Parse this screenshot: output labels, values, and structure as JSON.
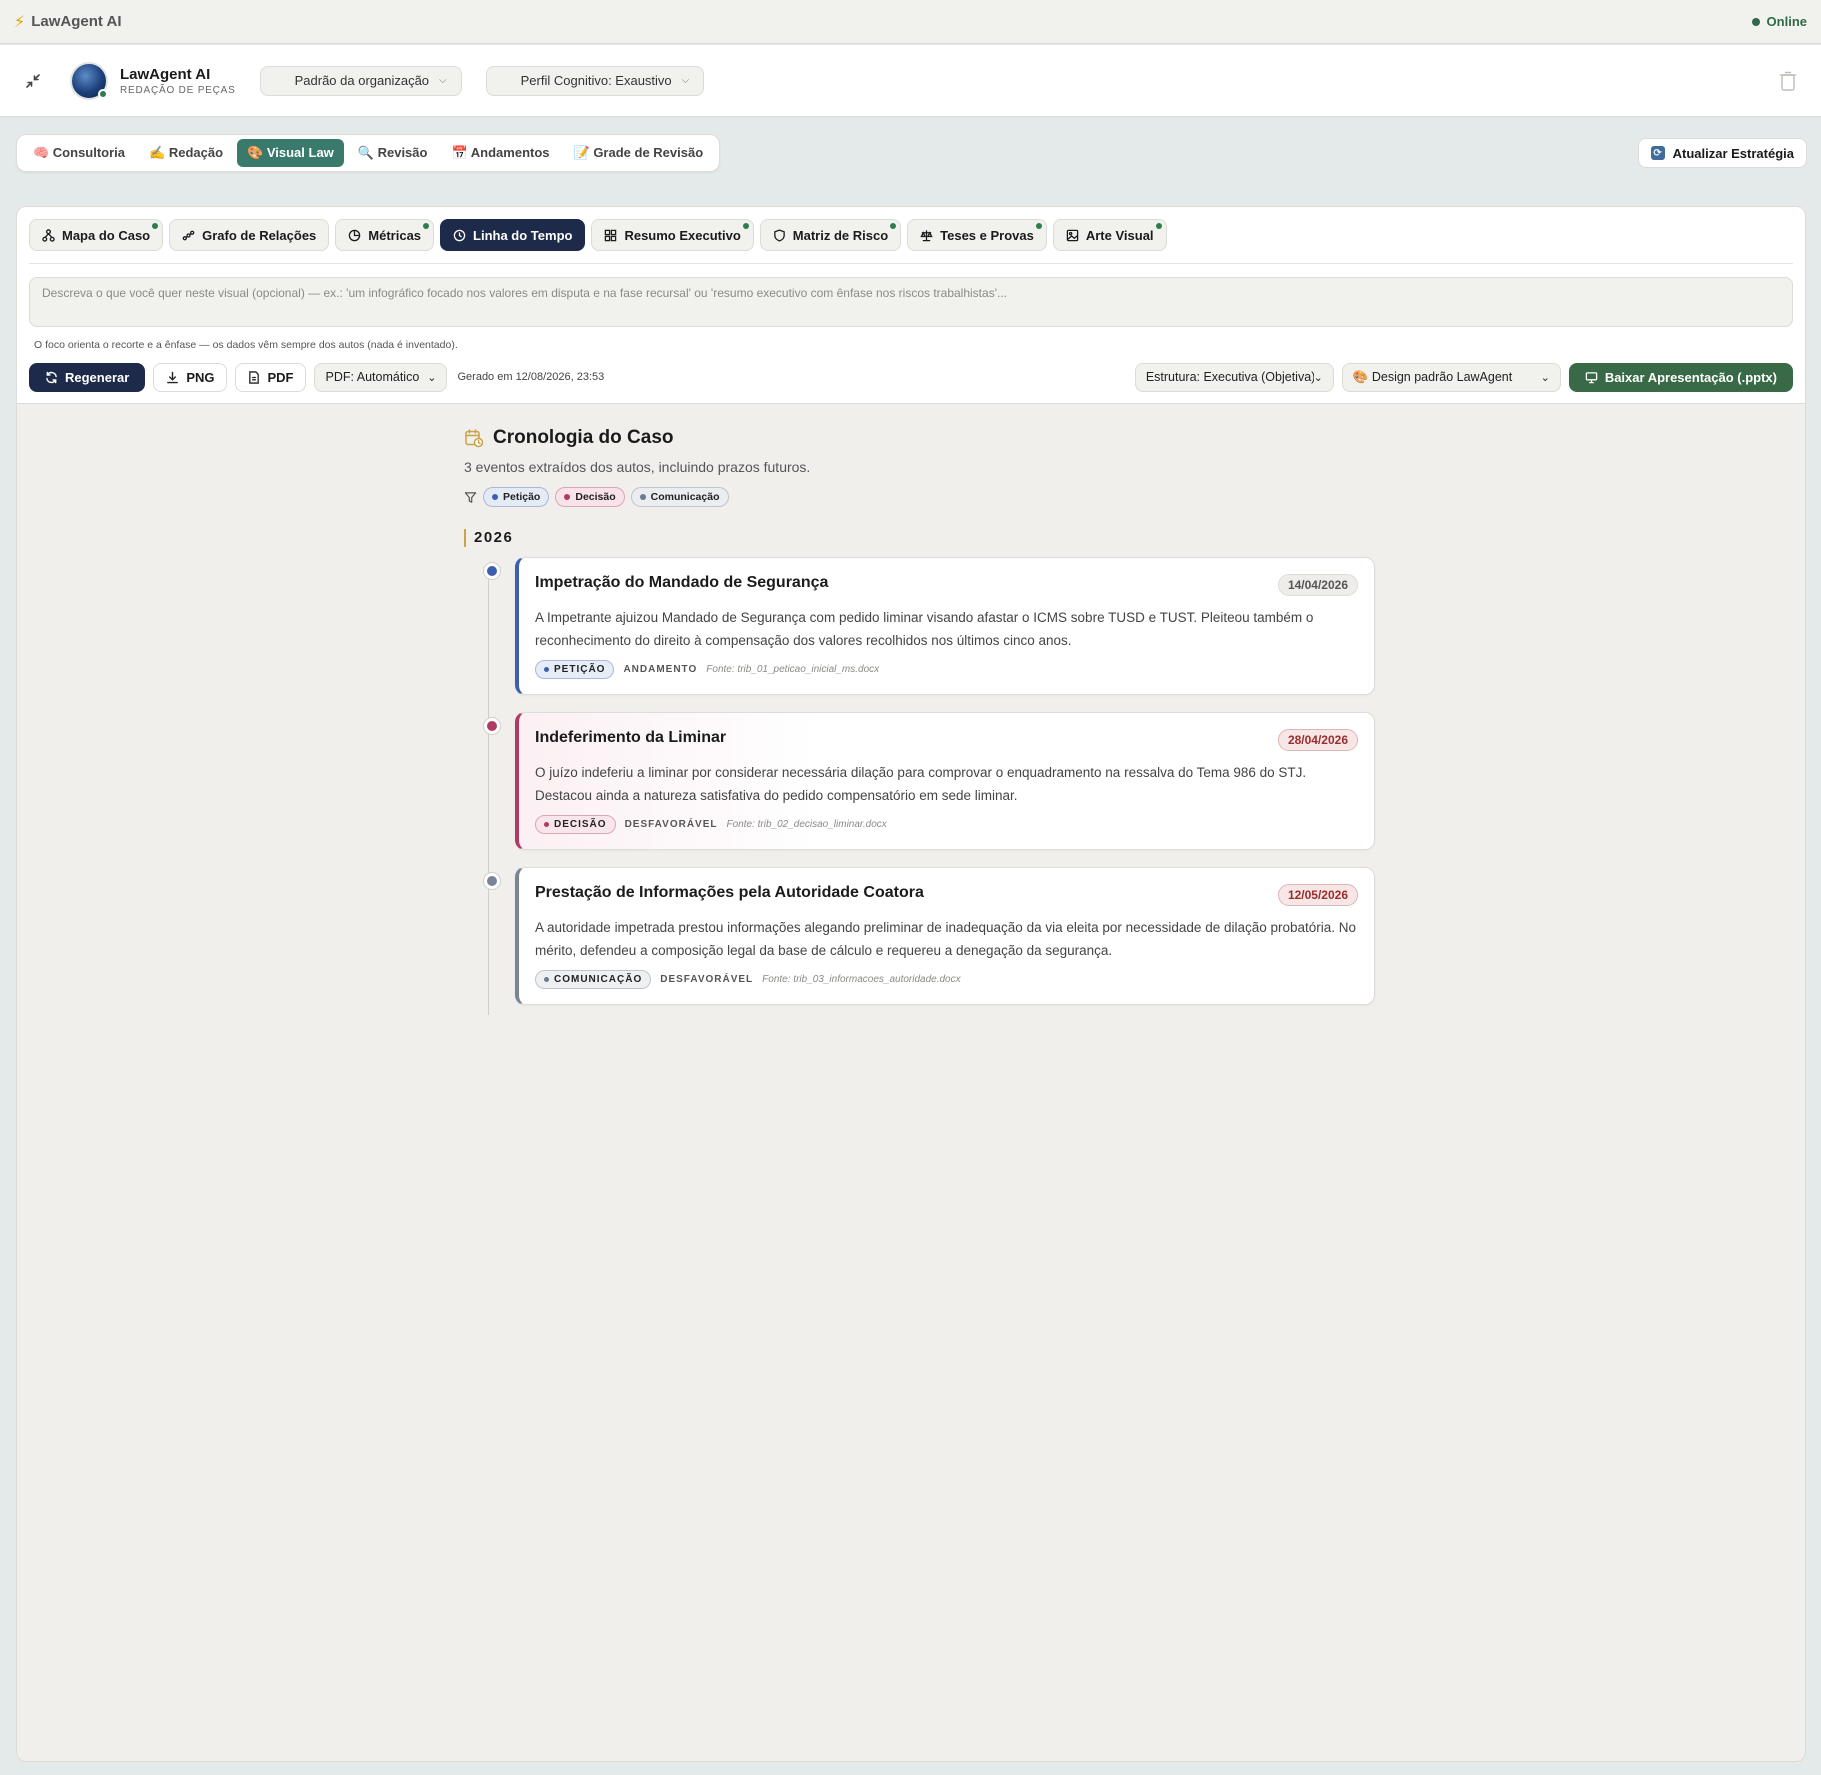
{
  "app": {
    "title": "LawAgent AI",
    "status": "Online"
  },
  "agent": {
    "name": "LawAgent AI",
    "subtitle": "REDAÇÃO DE PEÇAS",
    "org_profile": "Padrão da organização",
    "cognitive_profile": "Perfil Cognitivo: Exaustivo"
  },
  "main_tabs": [
    {
      "label": "🧠 Consultoria"
    },
    {
      "label": "✍️ Redação"
    },
    {
      "label": "🎨 Visual Law"
    },
    {
      "label": "🔍 Revisão"
    },
    {
      "label": "📅 Andamentos"
    },
    {
      "label": "📝 Grade de Revisão"
    }
  ],
  "active_main_tab": "Visual Law",
  "update_strategy_label": "Atualizar Estratégia",
  "sub_tabs": [
    {
      "label": "Mapa do Caso",
      "icon": "sitemap-icon"
    },
    {
      "label": "Grafo de Relações",
      "icon": "graph-icon"
    },
    {
      "label": "Métricas",
      "icon": "pie-chart-icon"
    },
    {
      "label": "Linha do Tempo",
      "icon": "clock-icon"
    },
    {
      "label": "Resumo Executivo",
      "icon": "dashboard-icon"
    },
    {
      "label": "Matriz de Risco",
      "icon": "shield-icon"
    },
    {
      "label": "Teses e Provas",
      "icon": "scale-icon"
    },
    {
      "label": "Arte Visual",
      "icon": "image-icon"
    }
  ],
  "prompt": {
    "placeholder": "Descreva o que você quer neste visual (opcional) — ex.: 'um infográfico focado nos valores em disputa e na fase recursal' ou 'resumo executivo com ênfase nos riscos trabalhistas'..."
  },
  "hint": "O foco orienta o recorte e a ênfase — os dados vêm sempre dos autos (nada é inventado).",
  "actions": {
    "regenerate": "Regenerar",
    "png": "PNG",
    "pdf": "PDF",
    "pdf_mode": "PDF: Automático",
    "generated_at": "Gerado em 12/08/2026, 23:53",
    "structure": "Estrutura: Executiva (Objetiva)",
    "design": "🎨 Design padrão LawAgent",
    "download": "Baixar Apresentação (.pptx)"
  },
  "timeline": {
    "title": "Cronologia do Caso",
    "subtitle": "3 eventos extraídos dos autos, incluindo prazos futuros.",
    "filters": [
      "Petição",
      "Decisão",
      "Comunicação"
    ],
    "year": "2026",
    "events": [
      {
        "title": "Impetração do Mandado de Segurança",
        "date": "14/04/2026",
        "description": "A Impetrante ajuizou Mandado de Segurança com pedido liminar visando afastar o ICMS sobre TUSD e TUST. Pleiteou também o reconhecimento do direito à compensação dos valores recolhidos nos últimos cinco anos.",
        "tag": "PETIÇÃO",
        "kind": "ANDAMENTO",
        "source": "Fonte: trib_01_peticao_inicial_ms.docx"
      },
      {
        "title": "Indeferimento da Liminar",
        "date": "28/04/2026",
        "description": "O juízo indeferiu a liminar por considerar necessária dilação para comprovar o enquadramento na ressalva do Tema 986 do STJ. Destacou ainda a natureza satisfativa do pedido compensatório em sede liminar.",
        "tag": "DECISÃO",
        "kind": "DESFAVORÁVEL",
        "source": "Fonte: trib_02_decisao_liminar.docx"
      },
      {
        "title": "Prestação de Informações pela Autoridade Coatora",
        "date": "12/05/2026",
        "description": "A autoridade impetrada prestou informações alegando preliminar de inadequação da via eleita por necessidade de dilação probatória. No mérito, defendeu a composição legal da base de cálculo e requereu a denegação da segurança.",
        "tag": "COMUNICAÇÃO",
        "kind": "DESFAVORÁVEL",
        "source": "Fonte: trib_03_informacoes_autoridade.docx"
      }
    ]
  },
  "colors": {
    "accent_teal": "#3a7a6c",
    "navy": "#1e2a4a",
    "green": "#386a48",
    "petition_blue": "#3d5fb0",
    "decision_pink": "#b03a63",
    "communication_gray": "#7a8399"
  }
}
